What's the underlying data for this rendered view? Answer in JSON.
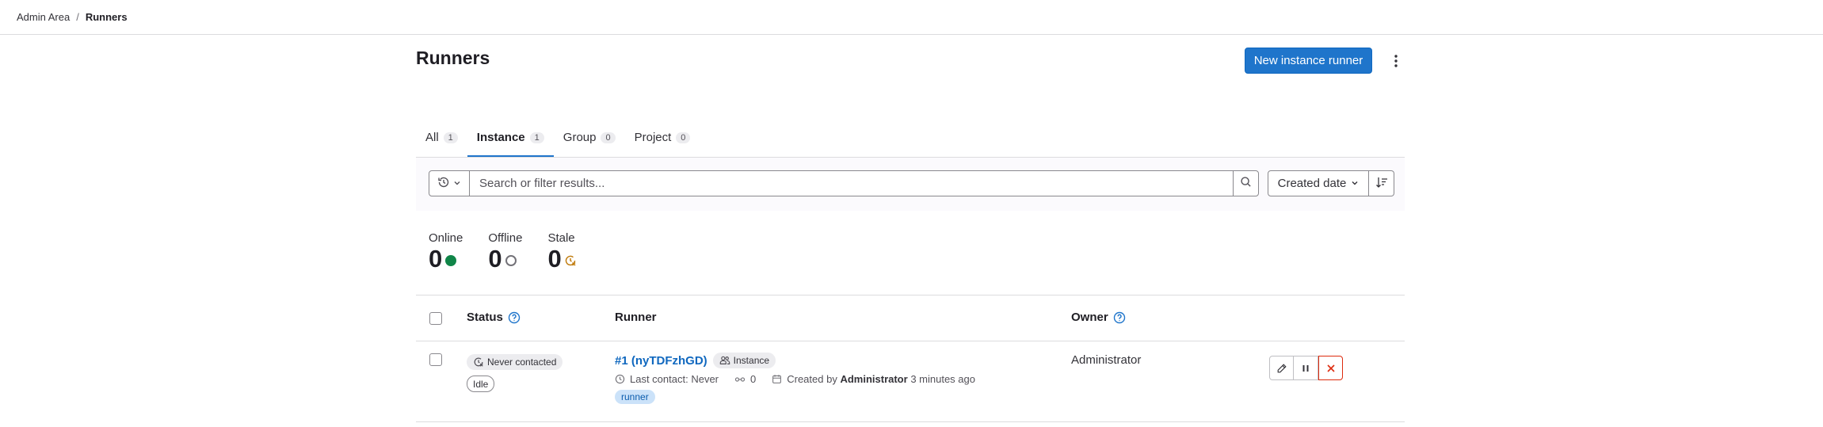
{
  "breadcrumb": {
    "parent": "Admin Area",
    "separator": "/",
    "current": "Runners"
  },
  "page": {
    "title": "Runners",
    "new_runner_button": "New instance runner"
  },
  "tabs": [
    {
      "label": "All",
      "count": "1",
      "active": false
    },
    {
      "label": "Instance",
      "count": "1",
      "active": true
    },
    {
      "label": "Group",
      "count": "0",
      "active": false
    },
    {
      "label": "Project",
      "count": "0",
      "active": false
    }
  ],
  "filter": {
    "search_placeholder": "Search or filter results...",
    "sort_label": "Created date"
  },
  "stats": {
    "online": {
      "label": "Online",
      "value": "0"
    },
    "offline": {
      "label": "Offline",
      "value": "0"
    },
    "stale": {
      "label": "Stale",
      "value": "0"
    }
  },
  "table": {
    "headers": {
      "status": "Status",
      "runner": "Runner",
      "owner": "Owner"
    },
    "rows": [
      {
        "status_badge": "Never contacted",
        "state_badge": "Idle",
        "runner_name": "#1 (nyTDFzhGD)",
        "runner_type": "Instance",
        "last_contact": "Last contact: Never",
        "jobs_count": "0",
        "created_prefix": "Created by",
        "created_by": "Administrator",
        "created_ago": "3 minutes ago",
        "tag": "runner",
        "owner": "Administrator"
      }
    ]
  },
  "colors": {
    "primary": "#1f75cb",
    "online": "#108548",
    "stale": "#c17d10",
    "danger": "#dd2b0e",
    "link": "#1068bf"
  },
  "icons": [
    "history-icon",
    "chevron-down-icon",
    "search-icon",
    "sort-lowest-icon",
    "kebab-icon",
    "help-icon",
    "status-online-icon",
    "status-offline-icon",
    "status-stale-icon",
    "time-out-icon",
    "users-icon",
    "clock-icon",
    "pipeline-icon",
    "calendar-icon",
    "pencil-icon",
    "pause-icon",
    "close-icon"
  ]
}
